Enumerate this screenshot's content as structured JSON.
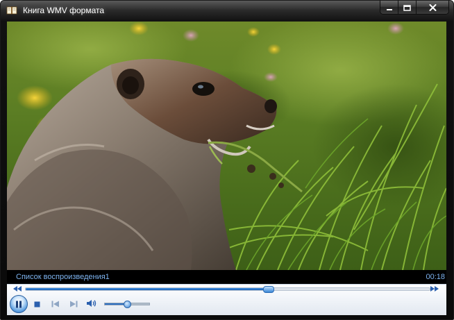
{
  "window": {
    "title": "Книга WMV формата",
    "app_icon": "book-icon",
    "caption_buttons": {
      "minimize_icon": "minimize-icon",
      "maximize_icon": "maximize-icon",
      "close_icon": "close-icon"
    }
  },
  "video": {
    "content": "marmot-in-grass-video-frame"
  },
  "status": {
    "playlist_name": "Список воспроизведения1",
    "elapsed_time": "00:18"
  },
  "controls": {
    "seek": {
      "progress_fraction": 0.6,
      "back_icon": "seek-back-icon",
      "forward_icon": "seek-forward-icon"
    },
    "play_pause_icon": "pause-icon",
    "stop_icon": "stop-icon",
    "previous_icon": "previous-icon",
    "next_icon": "next-icon",
    "mute_icon": "speaker-icon",
    "volume_fraction": 0.5
  },
  "colors": {
    "status_text": "#7eb4f0",
    "accent_blue": "#2c6fc2",
    "window_frame": "#111111"
  }
}
